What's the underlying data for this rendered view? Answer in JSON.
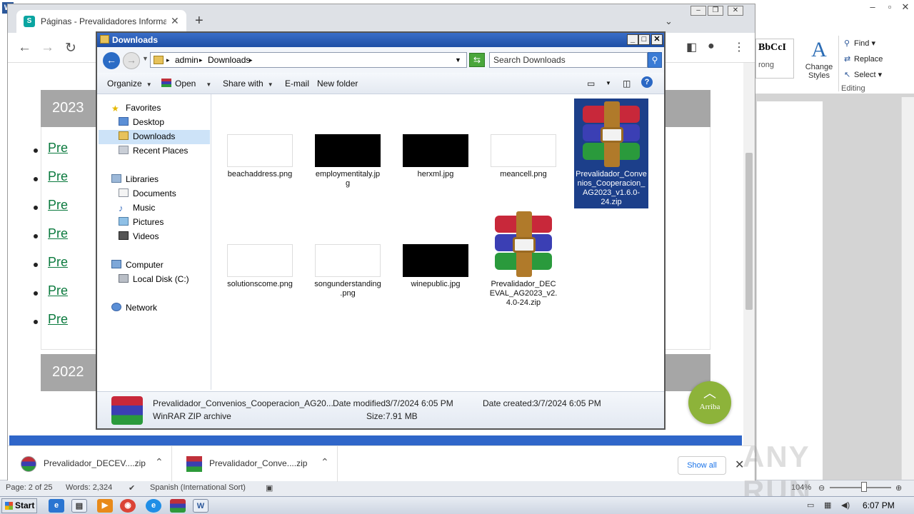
{
  "word": {
    "style_preview": "BbCcI",
    "style_name": "rong",
    "change_styles": "Change Styles",
    "find": "Find",
    "replace": "Replace",
    "select": "Select",
    "editing": "Editing",
    "status": {
      "page": "Page: 2 of 25",
      "words": "Words: 2,324",
      "language": "Spanish (International Sort)",
      "zoom": "104%"
    }
  },
  "chrome": {
    "tab_title": "Páginas - Prevalidadores Informacion",
    "years": [
      "2023",
      "2022"
    ],
    "links": [
      "Pre",
      "Pre",
      "Pre",
      "Pre",
      "Pre",
      "Pre",
      "Pre"
    ],
    "arriba": "Arriba",
    "downloads": [
      {
        "name": "Prevalidador_DECEV....zip"
      },
      {
        "name": "Prevalidador_Conve....zip"
      }
    ],
    "show_all": "Show all"
  },
  "explorer": {
    "title": "Downloads",
    "address": [
      "admin",
      "Downloads"
    ],
    "search_placeholder": "Search Downloads",
    "commands": {
      "organize": "Organize",
      "open": "Open",
      "share_with": "Share with",
      "email": "E-mail",
      "new_folder": "New folder"
    },
    "nav": {
      "favorites": "Favorites",
      "desktop": "Desktop",
      "downloads": "Downloads",
      "recent_places": "Recent Places",
      "libraries": "Libraries",
      "documents": "Documents",
      "music": "Music",
      "pictures": "Pictures",
      "videos": "Videos",
      "computer": "Computer",
      "local_disk": "Local Disk (C:)",
      "network": "Network"
    },
    "files": [
      {
        "name": "beachaddress.png",
        "kind": "image-light"
      },
      {
        "name": "employmentitaly.jpg",
        "kind": "image-dark"
      },
      {
        "name": "herxml.jpg",
        "kind": "image-dark"
      },
      {
        "name": "meancell.png",
        "kind": "image-light"
      },
      {
        "name": "Prevalidador_Convenios_Cooperacion_AG2023_v1.6.0-24.zip",
        "kind": "rar",
        "selected": true
      },
      {
        "name": "solutionscome.png",
        "kind": "image-light"
      },
      {
        "name": "songunderstanding.png",
        "kind": "image-light"
      },
      {
        "name": "winepublic.jpg",
        "kind": "image-dark"
      },
      {
        "name": "Prevalidador_DECEVAL_AG2023_v2.4.0-24.zip",
        "kind": "rar"
      }
    ],
    "details": {
      "filename": "Prevalidador_Convenios_Cooperacion_AG20...",
      "type": "WinRAR ZIP archive",
      "date_modified_label": "Date modified:",
      "date_modified": "3/7/2024 6:05 PM",
      "size_label": "Size:",
      "size": "7.91 MB",
      "date_created_label": "Date created:",
      "date_created": "3/7/2024 6:05 PM"
    }
  },
  "taskbar": {
    "start": "Start",
    "clock": "6:07 PM"
  },
  "watermark": "ANY RUN",
  "colors": {
    "link_green": "#0b7a3e",
    "arriba_green": "#8db33a",
    "selection_blue": "#1c3f8a",
    "titlebar_blue": "#1e4fa5"
  }
}
